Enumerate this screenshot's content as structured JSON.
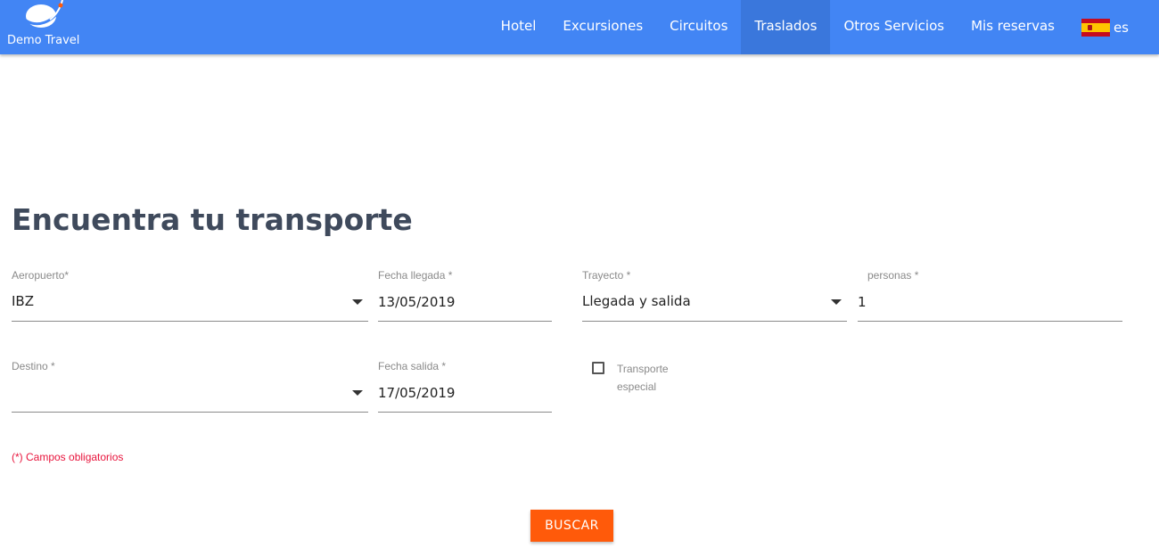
{
  "brand": {
    "name": "Demo Travel",
    "color": "#4285f4"
  },
  "nav": {
    "items": [
      {
        "label": "Hotel",
        "active": false
      },
      {
        "label": "Excursiones",
        "active": false
      },
      {
        "label": "Circuitos",
        "active": false
      },
      {
        "label": "Traslados",
        "active": true
      },
      {
        "label": "Otros Servicios",
        "active": false
      },
      {
        "label": "Mis reservas",
        "active": false
      }
    ],
    "language": {
      "flag": "spain-flag-icon",
      "label": "es"
    }
  },
  "page": {
    "title": "Encuentra tu transporte"
  },
  "form": {
    "airport": {
      "label": "Aeropuerto*",
      "value": "IBZ"
    },
    "arrival_date": {
      "label": "Fecha llegada *",
      "value": "13/05/2019"
    },
    "route": {
      "label": "Trayecto *",
      "value": "Llegada y salida"
    },
    "people": {
      "label": "personas *",
      "value": "1"
    },
    "destination": {
      "label": "Destino *",
      "value": ""
    },
    "departure_date": {
      "label": "Fecha salida *",
      "value": "17/05/2019"
    },
    "special_transport": {
      "label": "Transporte especial",
      "checked": false
    },
    "required_note": "(*) Campos obligatorios",
    "submit_label": "BUSCAR"
  },
  "colors": {
    "accent": "#ff5a0a",
    "required": "#e8143c",
    "title": "#3f4a5c"
  }
}
